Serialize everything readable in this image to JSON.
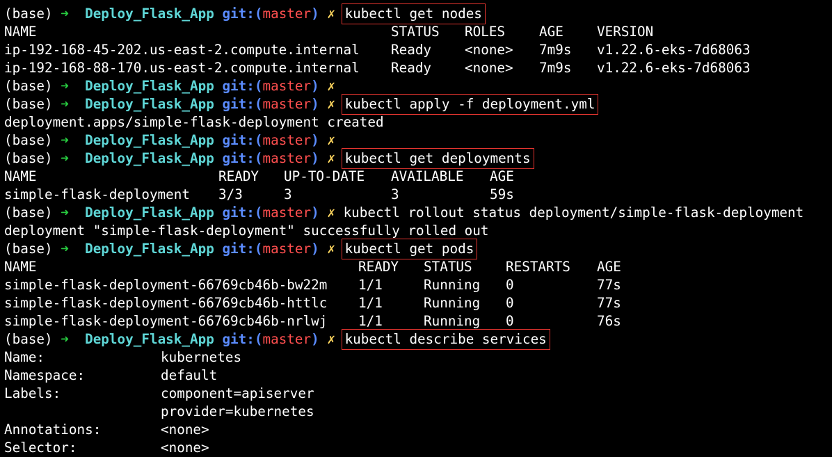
{
  "prompt": {
    "env": "(base)",
    "arrow": "➜",
    "dir": "Deploy_Flask_App",
    "git_prefix": "git:(",
    "branch": "master",
    "git_suffix": ")",
    "dirty": "✗"
  },
  "colors": {
    "background": "#000000",
    "arrow": "#27c93f",
    "directory": "#5fd7d7",
    "git": "#5b8cff",
    "branch": "#ff4f4f",
    "dirty_marker": "#ffd75f",
    "highlight_box": "#e3342f"
  },
  "cmd1": "kubectl get nodes",
  "nodes_header": [
    "NAME",
    "STATUS",
    "ROLES",
    "AGE",
    "VERSION"
  ],
  "nodes": [
    [
      "ip-192-168-45-202.us-east-2.compute.internal",
      "Ready",
      "<none>",
      "7m9s",
      "v1.22.6-eks-7d68063"
    ],
    [
      "ip-192-168-88-170.us-east-2.compute.internal",
      "Ready",
      "<none>",
      "7m9s",
      "v1.22.6-eks-7d68063"
    ]
  ],
  "cmd2": "kubectl apply -f deployment.yml",
  "apply_output": "deployment.apps/simple-flask-deployment created",
  "cmd3": "kubectl get deployments",
  "deploy_header": [
    "NAME",
    "READY",
    "UP-TO-DATE",
    "AVAILABLE",
    "AGE"
  ],
  "deployments": [
    [
      "simple-flask-deployment",
      "3/3",
      "3",
      "3",
      "59s"
    ]
  ],
  "cmd4": "kubectl rollout status deployment/simple-flask-deployment",
  "rollout_output": "deployment \"simple-flask-deployment\" successfully rolled out",
  "cmd5": "kubectl get pods",
  "pods_header": [
    "NAME",
    "READY",
    "STATUS",
    "RESTARTS",
    "AGE"
  ],
  "pods": [
    [
      "simple-flask-deployment-66769cb46b-bw22m",
      "1/1",
      "Running",
      "0",
      "77s"
    ],
    [
      "simple-flask-deployment-66769cb46b-httlc",
      "1/1",
      "Running",
      "0",
      "77s"
    ],
    [
      "simple-flask-deployment-66769cb46b-nrlwj",
      "1/1",
      "Running",
      "0",
      "76s"
    ]
  ],
  "cmd6": "kubectl describe services",
  "describe": [
    [
      "Name:",
      "kubernetes"
    ],
    [
      "Namespace:",
      "default"
    ],
    [
      "Labels:",
      "component=apiserver"
    ],
    [
      "",
      "provider=kubernetes"
    ],
    [
      "Annotations:",
      "<none>"
    ],
    [
      "Selector:",
      "<none>"
    ]
  ]
}
